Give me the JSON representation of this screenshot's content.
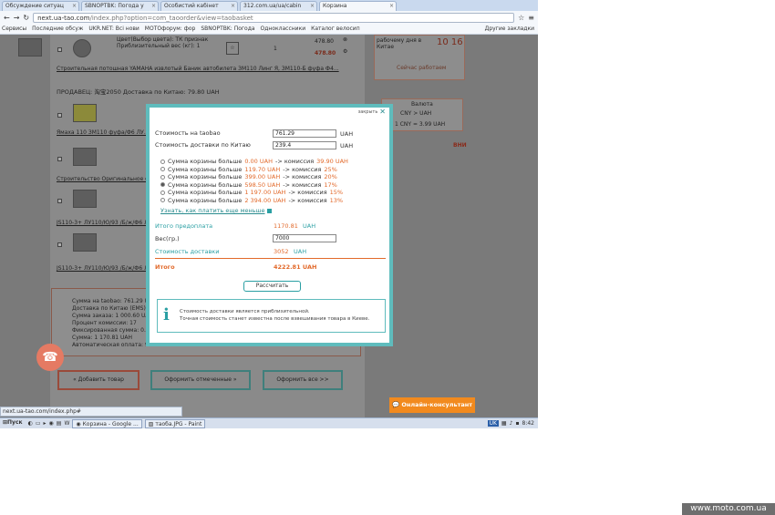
{
  "browser": {
    "tabs": [
      {
        "label": "Обсуждение ситуац",
        "active": false
      },
      {
        "label": "SBNOPTBK: Погода у",
        "active": false
      },
      {
        "label": "Особистий кабінет",
        "active": false
      },
      {
        "label": "312.com.ua/ua/cabin",
        "active": false
      },
      {
        "label": "Корзина",
        "active": true
      }
    ],
    "url_host": "next.ua-tao.com",
    "url_rest": "/index.php?option=com_taoorder&view=taobasket",
    "bookmarks": [
      "Сервисы",
      "Последние обсуж",
      "UKR.NET: Всі нови",
      "МОТОфорум: фор",
      "SBNOPTBK: Погода",
      "Одноклассники",
      "Каталог велосип"
    ],
    "other_bookmarks": "Другие закладки",
    "status_url": "next.ua-tao.com/index.php#"
  },
  "background": {
    "product1_color": "Цвет(Выбор цвета): ТК признак",
    "product1_weight": "Приблизительный вес (кг): 1",
    "product1_qty": "1",
    "product1_price": "478.80",
    "product1_total": "478.80",
    "product1_link": "Строительная потошная YAMAHA извлотый Баник автобилета ЗМ110 Линг Я, ЗМ110-Б фуфа Ф4...",
    "seller": "ПРОДАВЕЦ: 淘宝2050 Доставка по Китаю: 79.80 UAH",
    "product2_link": "Ямаха 110 ЗМ110 фуфа/Ф6 ЛУ...",
    "product3_link": "Строительство Оригинальное ф...",
    "product4_link": "JS110-3+ ЛУ110/Ю/93 /Б/ж/Ф6 Л...",
    "product5_link": "JS110-3+ ЛУ110/Ю/93 /Б/ж/Ф6 Л...",
    "days_label": "рабочему дня в Китае",
    "time": "10 16",
    "working_now": "Сейчас работаем",
    "currency_label": "Валюта",
    "currency_pair": "CNY > UAH",
    "rate": "1 CNY = 3.99 UAH",
    "summary_lines": [
      "Сумма на taobao: 761.29 U...",
      "Доставка по Китаю (EMS): ...",
      "Сумма заказа: 1 000.60 UA...",
      "Процент комиссии: 17",
      "Фиксированная сумма: 0.0...",
      "Сумма: 1 170.81 UAH",
      "Автоматическая оплата: 9..."
    ],
    "btn_add": "« Добавить товар",
    "btn_order_selected": "Оформить отмеченные »",
    "btn_order_all": "Оформить все >>",
    "banner": "ВНИ"
  },
  "modal": {
    "close_label": "закрыть",
    "taobao_label": "Стоимость на taobao",
    "taobao_value": "761.29",
    "shipping_cn_label": "Стоимость доставки по Китаю",
    "shipping_cn_value": "239.4",
    "currency": "UAH",
    "options": [
      {
        "prefix": "Сумма корзины больше",
        "amount": "0.00 UAH",
        "mid": "-> комиссия",
        "pct": "39.90 UAH",
        "selected": false
      },
      {
        "prefix": "Сумма корзины больше",
        "amount": "119.70 UAH",
        "mid": "-> комиссия",
        "pct": "25%",
        "selected": false
      },
      {
        "prefix": "Сумма корзины больше",
        "amount": "399.00 UAH",
        "mid": "-> комиссия",
        "pct": "20%",
        "selected": false
      },
      {
        "prefix": "Сумма корзины больше",
        "amount": "598.50 UAH",
        "mid": "-> комиссия",
        "pct": "17%",
        "selected": true
      },
      {
        "prefix": "Сумма корзины больше",
        "amount": "1 197.00 UAH",
        "mid": "-> комиссия",
        "pct": "15%",
        "selected": false
      },
      {
        "prefix": "Сумма корзины больше",
        "amount": "2 394.00 UAH",
        "mid": "-> комиссия",
        "pct": "13%",
        "selected": false
      }
    ],
    "learn_link": "Узнать, как платить еще меньше",
    "prepay_label": "Итого предоплата",
    "prepay_value": "1170.81",
    "weight_label": "Вес(гр.)",
    "weight_value": "7000",
    "delivery_label": "Стоимость доставки",
    "delivery_value": "3052",
    "total_label": "Итого",
    "total_value": "4222.81 UAH",
    "calc_button": "Рассчитать",
    "info_line1": "Стоимость доставки является приблизительной.",
    "info_line2": "Точная стоимость станет известна после взвешивания товара в Киеве."
  },
  "chat_label": "Онлайн-консультант",
  "taskbar": {
    "start": "Пуск",
    "tasks": [
      "Корзина - Google ...",
      "таоба.JPG - Paint"
    ],
    "lang": "UK",
    "clock": "8:42"
  },
  "watermark": "www.moto.com.ua"
}
